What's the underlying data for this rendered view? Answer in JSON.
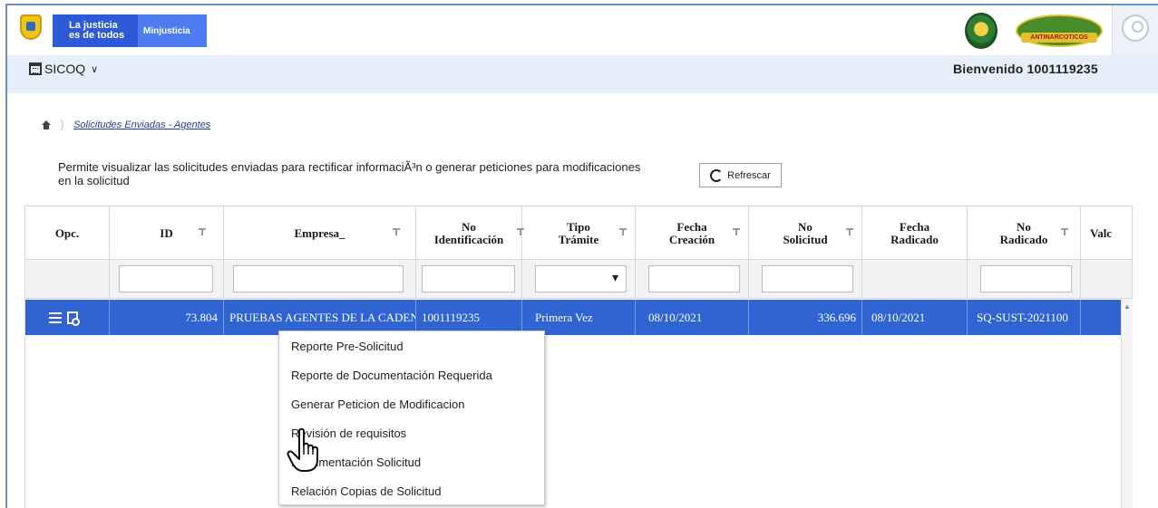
{
  "header": {
    "brand_line1": "La justicia",
    "brand_line2": "es de todos",
    "brand_ministry": "Minjusticia",
    "emblem2_text": "ANTINARCOTICOS"
  },
  "subbar": {
    "app_name": "SICOQ",
    "welcome": "Bienvenido 1001119235"
  },
  "breadcrumb": {
    "current": "Solicitudes Enviadas - Agentes"
  },
  "description": "Permite visualizar las solicitudes enviadas para rectificar informaciÃ³n o generar peticiones para modificaciones en la solicitud",
  "refresh_label": "Refrescar",
  "grid": {
    "columns": [
      {
        "line1": "Opc.",
        "line2": ""
      },
      {
        "line1": "ID",
        "line2": ""
      },
      {
        "line1": "Empresa_",
        "line2": ""
      },
      {
        "line1": "No",
        "line2": "Identificación"
      },
      {
        "line1": "Tipo",
        "line2": "Trámite"
      },
      {
        "line1": "Fecha",
        "line2": "Creación"
      },
      {
        "line1": "No",
        "line2": "Solicitud"
      },
      {
        "line1": "Fecha",
        "line2": "Radicado"
      },
      {
        "line1": "No",
        "line2": "Radicado"
      },
      {
        "line1": "Valc",
        "line2": ""
      }
    ],
    "row": {
      "id": "73.804",
      "empresa": "PRUEBAS AGENTES DE LA CADENA",
      "no_identificacion": "1001119235",
      "tipo_tramite": "Primera Vez",
      "fecha_creacion": "08/10/2021",
      "no_solicitud": "336.696",
      "fecha_radicado": "08/10/2021",
      "no_radicado": "SQ-SUST-2021100"
    }
  },
  "context_menu": [
    "Reporte Pre-Solicitud",
    "Reporte de Documentación Requerida",
    "Generar Peticion de Modificacion",
    "Revisión de requisitos",
    "Documentación Solicitud",
    "Relación Copias de Solicitud"
  ]
}
